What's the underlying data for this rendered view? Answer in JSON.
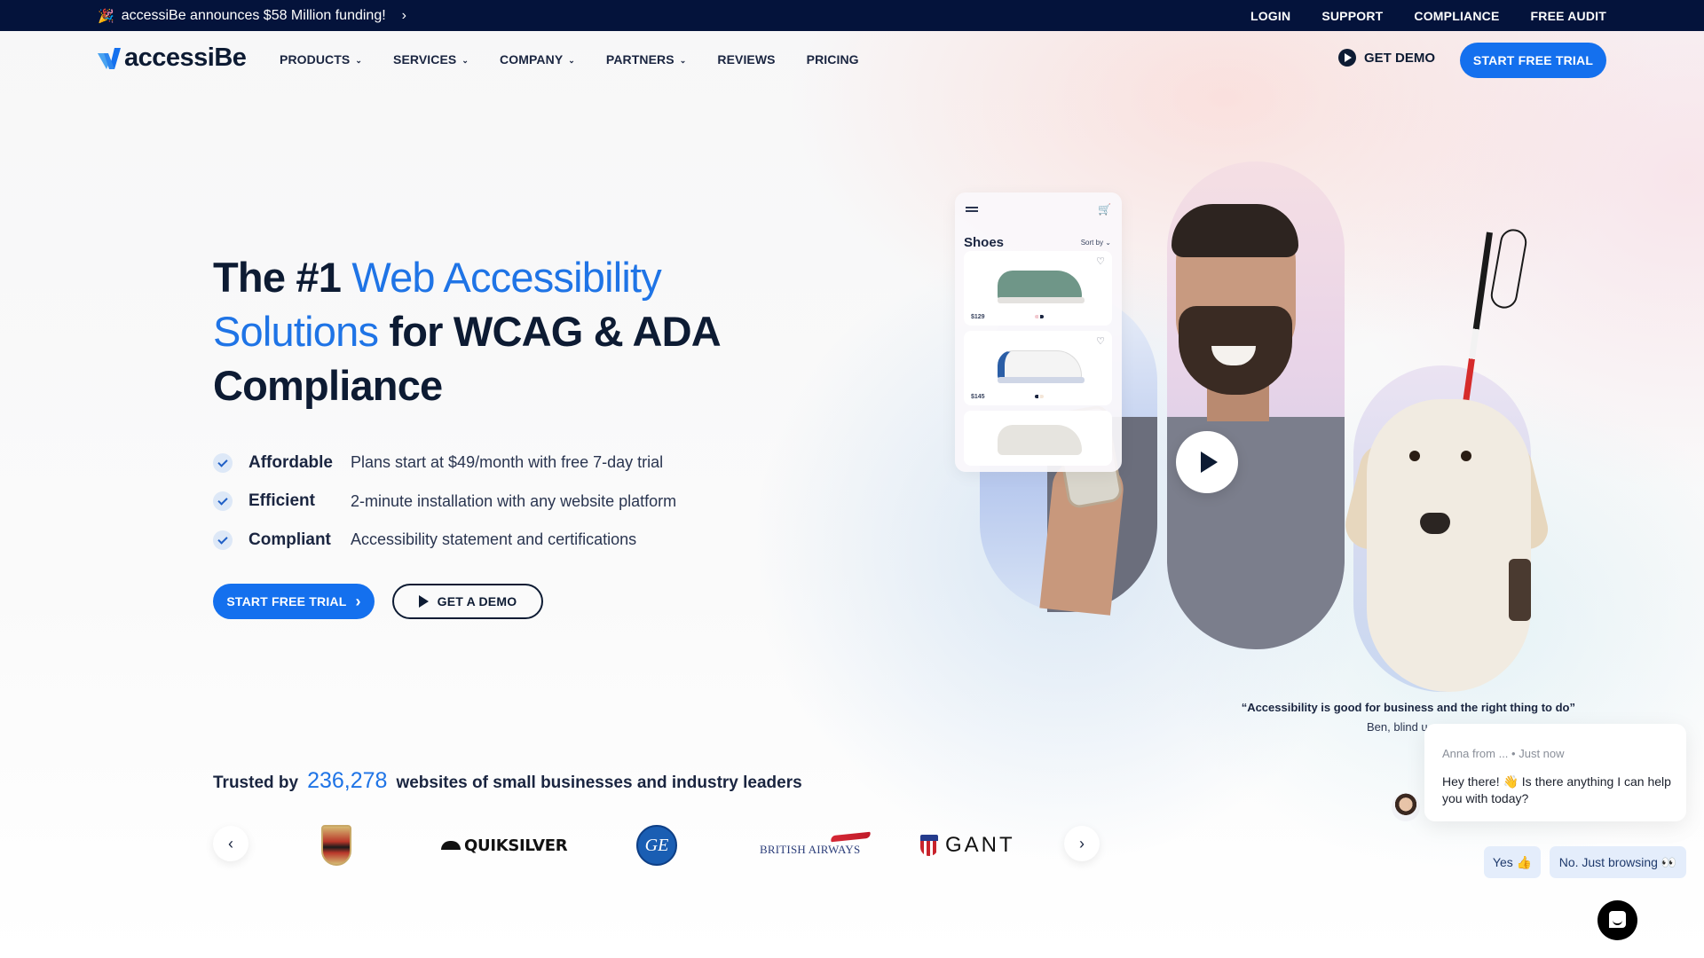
{
  "announcement": {
    "icon": "party-popper-icon",
    "emoji": "🎉",
    "text": "accessiBe announces $58 Million funding!",
    "chevron": "›"
  },
  "topnav": [
    "LOGIN",
    "SUPPORT",
    "COMPLIANCE",
    "FREE AUDIT"
  ],
  "brand": {
    "name": "accessiBe",
    "accent": "#1470ee",
    "dark": "#0d1b33"
  },
  "mainnav": {
    "items": [
      {
        "label": "PRODUCTS",
        "dropdown": true
      },
      {
        "label": "SERVICES",
        "dropdown": true
      },
      {
        "label": "COMPANY",
        "dropdown": true
      },
      {
        "label": "PARTNERS",
        "dropdown": true
      },
      {
        "label": "REVIEWS",
        "dropdown": false
      },
      {
        "label": "PRICING",
        "dropdown": false
      }
    ],
    "caret": "⌄",
    "get_demo": "GET DEMO",
    "start_trial": "START FREE TRIAL"
  },
  "hero": {
    "title_prefix": "The #1 ",
    "title_highlight": "Web Accessibility Solutions",
    "title_suffix": " for WCAG & ADA Compliance",
    "features": [
      {
        "name": "Affordable",
        "desc": "Plans start at $49/month with free 7-day trial"
      },
      {
        "name": "Efficient",
        "desc": "2-minute installation with any website platform"
      },
      {
        "name": "Compliant",
        "desc": "Accessibility statement and certifications"
      }
    ],
    "cta_trial": "START FREE TRIAL",
    "cta_trial_chevron": "›",
    "cta_demo": "GET A DEMO"
  },
  "showcase": {
    "shop": {
      "title": "Shoes",
      "sort": "Sort by ⌄",
      "cart_icon": "🛒",
      "items": [
        {
          "price": "$129",
          "color": "#6f9688"
        },
        {
          "price": "$145",
          "color": "#f4f4f4"
        },
        {
          "price": "",
          "color": "#e6e4df"
        }
      ],
      "heart": "♡"
    },
    "quote": "“Accessibility is good for business and the right thing to do”",
    "quote_by": "Ben, blind u"
  },
  "trusted": {
    "prefix": "Trusted by",
    "count": "236,278",
    "suffix": "websites of small businesses and industry leaders",
    "prev": "‹",
    "next": "›",
    "logos": [
      "PORSCHE",
      "QUIKSILVER",
      "GE",
      "BRITISH AIRWAYS",
      "GANT"
    ]
  },
  "chat": {
    "sender": "Anna from ...",
    "time": "• Just now",
    "message": "Hey there! 👋 Is there anything I can help you with today?",
    "replies": [
      "Yes 👍",
      "No. Just browsing 👀"
    ]
  }
}
